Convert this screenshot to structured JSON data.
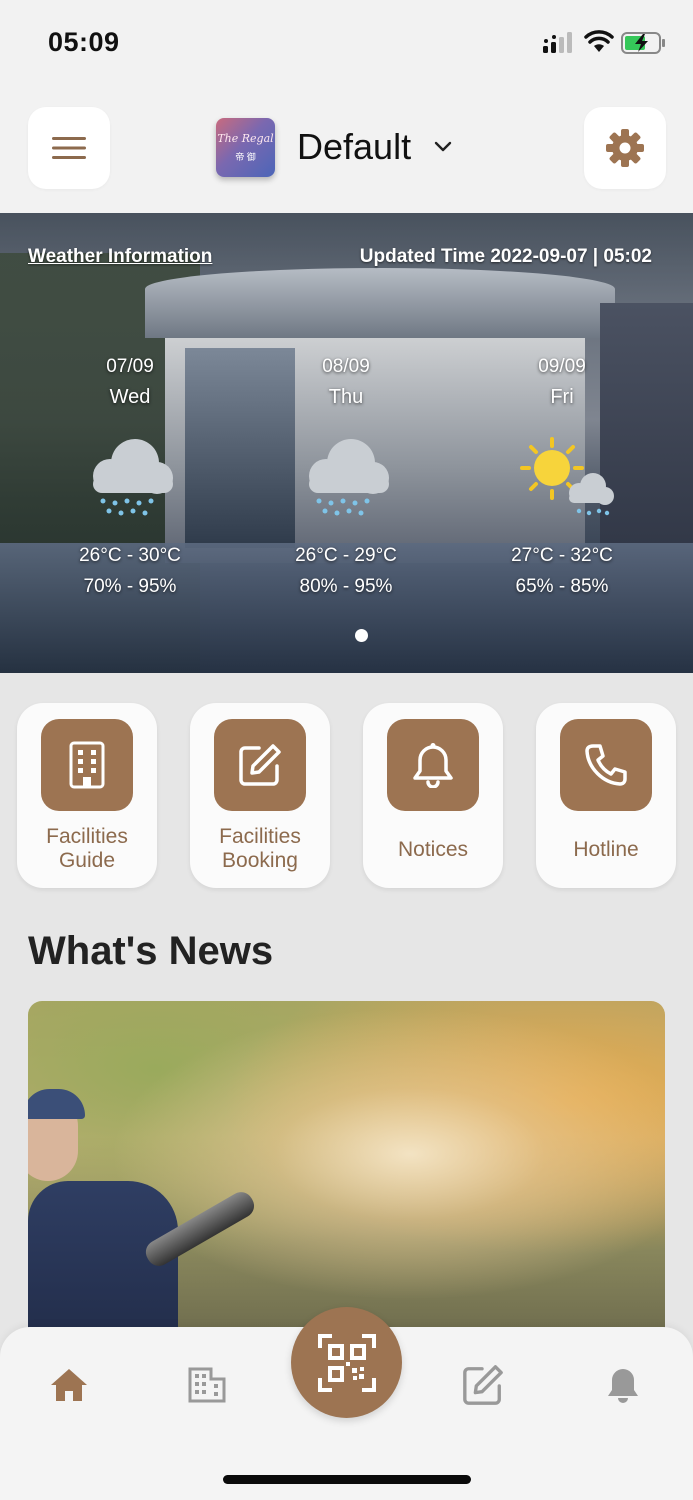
{
  "status_bar": {
    "time": "05:09"
  },
  "header": {
    "logo_script": "The Regal",
    "logo_chinese": "帝 御",
    "title": "Default",
    "icons": {
      "menu": "menu-icon",
      "settings": "gear-icon",
      "dropdown": "chevron-down-icon"
    }
  },
  "weather": {
    "link_label": "Weather Information",
    "updated": "Updated Time 2022-09-07 | 05:02",
    "days": [
      {
        "date": "07/09",
        "weekday": "Wed",
        "icon": "rain-cloud-icon",
        "temp": "26°C - 30°C",
        "humidity": "70% - 95%"
      },
      {
        "date": "08/09",
        "weekday": "Thu",
        "icon": "rain-cloud-icon",
        "temp": "26°C - 29°C",
        "humidity": "80% - 95%"
      },
      {
        "date": "09/09",
        "weekday": "Fri",
        "icon": "sun-rain-icon",
        "temp": "27°C - 32°C",
        "humidity": "65% - 85%"
      }
    ]
  },
  "quick_actions": [
    {
      "label": "Facilities Guide",
      "icon": "building-icon"
    },
    {
      "label": "Facilities Booking",
      "icon": "edit-icon"
    },
    {
      "label": "Notices",
      "icon": "bell-icon"
    },
    {
      "label": "Hotline",
      "icon": "phone-icon"
    }
  ],
  "news": {
    "title": "What's News"
  },
  "tabbar": {
    "items": [
      "home-icon",
      "building-icon",
      "qr-code-icon",
      "edit-icon",
      "bell-icon"
    ],
    "active": "home-icon"
  },
  "colors": {
    "accent": "#9d7452",
    "accent_text": "#8c6a4d",
    "inactive_icon": "#999999"
  }
}
